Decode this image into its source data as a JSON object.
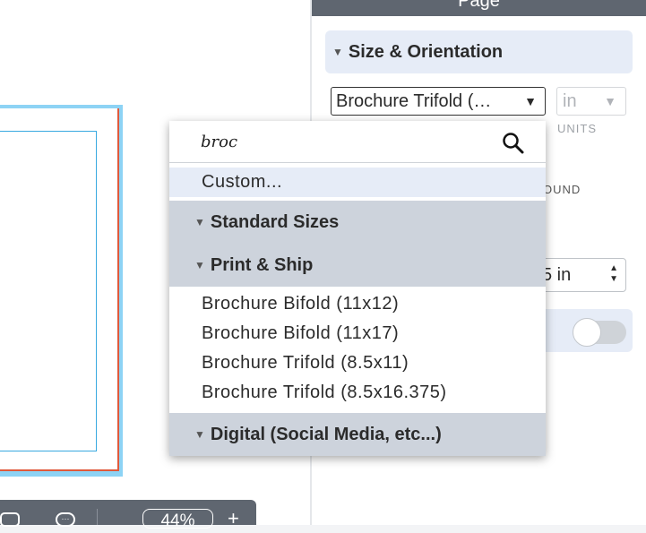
{
  "canvas": {
    "zoom_value": "44%",
    "zoom_plus": "+"
  },
  "panel": {
    "title": "Page",
    "section_title": "Size & Orientation",
    "size_select_value": "Brochure Trifold (…",
    "units_select_value": "in",
    "units_label": "UNITS",
    "bound_label_partial": "OUND",
    "stepper_value_partial": "5 in"
  },
  "dropdown": {
    "search_value": "broc",
    "custom_label": "Custom...",
    "groups": [
      {
        "label": "Standard Sizes"
      },
      {
        "label": "Print & Ship"
      },
      {
        "label": "Digital (Social Media, etc...)"
      }
    ],
    "options": [
      "Brochure Bifold (11x12)",
      "Brochure Bifold (11x17)",
      "Brochure Trifold (8.5x11)",
      "Brochure Trifold (8.5x16.375)"
    ]
  },
  "icons": {
    "search": "search-icon",
    "collapse": "triangle-down-icon",
    "caret": "chevron-down-icon"
  }
}
